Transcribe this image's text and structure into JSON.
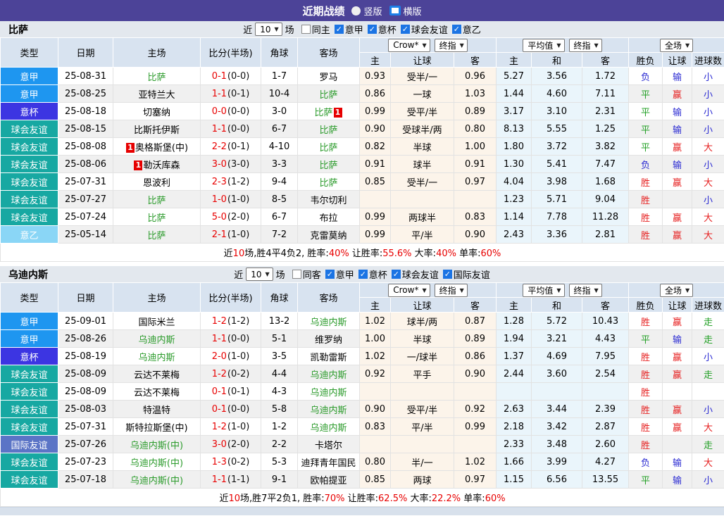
{
  "topbar": {
    "title": "近期战绩",
    "radios": [
      {
        "label": "竖版",
        "selected": false
      },
      {
        "label": "横版",
        "selected": true
      }
    ]
  },
  "type_colors": {
    "意甲": "#1e96f0",
    "意杯": "#3c35e2",
    "球会友谊": "#17a8a2",
    "意乙": "#8ad6f6",
    "国际友谊": "#5b74c6"
  },
  "result_colors": {
    "胜": "#e62020",
    "赢": "#e62020",
    "大": "#e62020",
    "负": "#2a2ad2",
    "输": "#2a2ad2",
    "小": "#2a2ad2",
    "平": "#23a026",
    "走": "#23a026"
  },
  "columns": [
    "类型",
    "日期",
    "主场",
    "比分(半场)",
    "角球",
    "客场"
  ],
  "sub_columns": [
    "主",
    "让球",
    "客",
    "主",
    "和",
    "客",
    "胜负",
    "让球",
    "进球数"
  ],
  "sections": [
    {
      "team": "比萨",
      "filter": {
        "near_label": "近",
        "count": "10",
        "games_label": "场",
        "checkboxes": [
          {
            "label": "同主",
            "checked": false
          },
          {
            "label": "意甲",
            "checked": true
          },
          {
            "label": "意杯",
            "checked": true
          },
          {
            "label": "球会友谊",
            "checked": true
          },
          {
            "label": "意乙",
            "checked": true
          }
        ]
      },
      "selects": {
        "bookmaker": "Crow*",
        "odds_time1": "终指",
        "average": "平均值",
        "odds_time2": "终指",
        "scope": "全场"
      },
      "rows": [
        {
          "type": "意甲",
          "date": "25-08-31",
          "home": {
            "name": "比萨",
            "green": true
          },
          "score": "0-1",
          "half": "(0-0)",
          "corner": "1-7",
          "away": {
            "name": "罗马",
            "green": false
          },
          "crow": [
            "0.93",
            "受半/一",
            "0.96"
          ],
          "avg": [
            "5.27",
            "3.56",
            "1.72"
          ],
          "res": [
            "负",
            "输",
            "小"
          ]
        },
        {
          "type": "意甲",
          "date": "25-08-25",
          "home": {
            "name": "亚特兰大",
            "green": false
          },
          "score": "1-1",
          "half": "(0-1)",
          "corner": "10-4",
          "away": {
            "name": "比萨",
            "green": true
          },
          "crow": [
            "0.86",
            "一球",
            "1.03"
          ],
          "avg": [
            "1.44",
            "4.60",
            "7.11"
          ],
          "res": [
            "平",
            "赢",
            "小"
          ]
        },
        {
          "type": "意杯",
          "date": "25-08-18",
          "home": {
            "name": "切塞纳",
            "green": false
          },
          "score": "0-0",
          "half": "(0-0)",
          "corner": "3-0",
          "away": {
            "name": "比萨",
            "green": true,
            "badge": "1",
            "badge_pos": "after"
          },
          "crow": [
            "0.99",
            "受平/半",
            "0.89"
          ],
          "avg": [
            "3.17",
            "3.10",
            "2.31"
          ],
          "res": [
            "平",
            "输",
            "小"
          ]
        },
        {
          "type": "球会友谊",
          "date": "25-08-15",
          "home": {
            "name": "比斯托伊斯",
            "green": false
          },
          "score": "1-1",
          "half": "(0-0)",
          "corner": "6-7",
          "away": {
            "name": "比萨",
            "green": true
          },
          "crow": [
            "0.90",
            "受球半/两",
            "0.80"
          ],
          "avg": [
            "8.13",
            "5.55",
            "1.25"
          ],
          "res": [
            "平",
            "输",
            "小"
          ]
        },
        {
          "type": "球会友谊",
          "date": "25-08-08",
          "home": {
            "name": "奥格斯堡(中)",
            "green": false,
            "badge": "1",
            "badge_pos": "before"
          },
          "score": "2-2",
          "half": "(0-1)",
          "corner": "4-10",
          "away": {
            "name": "比萨",
            "green": true
          },
          "crow": [
            "0.82",
            "半球",
            "1.00"
          ],
          "avg": [
            "1.80",
            "3.72",
            "3.82"
          ],
          "res": [
            "平",
            "赢",
            "大"
          ]
        },
        {
          "type": "球会友谊",
          "date": "25-08-06",
          "home": {
            "name": "勒沃库森",
            "green": false,
            "badge": "1",
            "badge_pos": "before"
          },
          "score": "3-0",
          "half": "(3-0)",
          "corner": "3-3",
          "away": {
            "name": "比萨",
            "green": true
          },
          "crow": [
            "0.91",
            "球半",
            "0.91"
          ],
          "avg": [
            "1.30",
            "5.41",
            "7.47"
          ],
          "res": [
            "负",
            "输",
            "小"
          ]
        },
        {
          "type": "球会友谊",
          "date": "25-07-31",
          "home": {
            "name": "恩波利",
            "green": false
          },
          "score": "2-3",
          "half": "(1-2)",
          "corner": "9-4",
          "away": {
            "name": "比萨",
            "green": true
          },
          "crow": [
            "0.85",
            "受半/一",
            "0.97"
          ],
          "avg": [
            "4.04",
            "3.98",
            "1.68"
          ],
          "res": [
            "胜",
            "赢",
            "大"
          ]
        },
        {
          "type": "球会友谊",
          "date": "25-07-27",
          "home": {
            "name": "比萨",
            "green": true
          },
          "score": "1-0",
          "half": "(1-0)",
          "corner": "8-5",
          "away": {
            "name": "韦尔切利",
            "green": false
          },
          "crow": [
            "",
            "",
            ""
          ],
          "avg": [
            "1.23",
            "5.71",
            "9.04"
          ],
          "res": [
            "胜",
            "",
            "小"
          ]
        },
        {
          "type": "球会友谊",
          "date": "25-07-24",
          "home": {
            "name": "比萨",
            "green": true
          },
          "score": "5-0",
          "half": "(2-0)",
          "corner": "6-7",
          "away": {
            "name": "布拉",
            "green": false
          },
          "crow": [
            "0.99",
            "两球半",
            "0.83"
          ],
          "avg": [
            "1.14",
            "7.78",
            "11.28"
          ],
          "res": [
            "胜",
            "赢",
            "大"
          ]
        },
        {
          "type": "意乙",
          "date": "25-05-14",
          "home": {
            "name": "比萨",
            "green": true
          },
          "score": "2-1",
          "half": "(1-0)",
          "corner": "7-2",
          "away": {
            "name": "克雷莫纳",
            "green": false
          },
          "crow": [
            "0.99",
            "平/半",
            "0.90"
          ],
          "avg": [
            "2.43",
            "3.36",
            "2.81"
          ],
          "res": [
            "胜",
            "赢",
            "大"
          ]
        }
      ],
      "summary": [
        {
          "t": "近",
          "r": 0
        },
        {
          "t": "10",
          "r": 1
        },
        {
          "t": "场,胜4平4负2, 胜率:",
          "r": 0
        },
        {
          "t": "40%",
          "r": 1
        },
        {
          "t": " 让胜率:",
          "r": 0
        },
        {
          "t": "55.6%",
          "r": 1
        },
        {
          "t": " 大率:",
          "r": 0
        },
        {
          "t": "40%",
          "r": 1
        },
        {
          "t": " 单率:",
          "r": 0
        },
        {
          "t": "60%",
          "r": 1
        }
      ]
    },
    {
      "team": "乌迪内斯",
      "filter": {
        "near_label": "近",
        "count": "10",
        "games_label": "场",
        "checkboxes": [
          {
            "label": "同客",
            "checked": false
          },
          {
            "label": "意甲",
            "checked": true
          },
          {
            "label": "意杯",
            "checked": true
          },
          {
            "label": "球会友谊",
            "checked": true
          },
          {
            "label": "国际友谊",
            "checked": true
          }
        ]
      },
      "selects": {
        "bookmaker": "Crow*",
        "odds_time1": "终指",
        "average": "平均值",
        "odds_time2": "终指",
        "scope": "全场"
      },
      "rows": [
        {
          "type": "意甲",
          "date": "25-09-01",
          "home": {
            "name": "国际米兰",
            "green": false
          },
          "score": "1-2",
          "half": "(1-2)",
          "corner": "13-2",
          "away": {
            "name": "乌迪内斯",
            "green": true
          },
          "crow": [
            "1.02",
            "球半/两",
            "0.87"
          ],
          "avg": [
            "1.28",
            "5.72",
            "10.43"
          ],
          "res": [
            "胜",
            "赢",
            "走"
          ]
        },
        {
          "type": "意甲",
          "date": "25-08-26",
          "home": {
            "name": "乌迪内斯",
            "green": true
          },
          "score": "1-1",
          "half": "(0-0)",
          "corner": "5-1",
          "away": {
            "name": "维罗纳",
            "green": false
          },
          "crow": [
            "1.00",
            "半球",
            "0.89"
          ],
          "avg": [
            "1.94",
            "3.21",
            "4.43"
          ],
          "res": [
            "平",
            "输",
            "走"
          ]
        },
        {
          "type": "意杯",
          "date": "25-08-19",
          "home": {
            "name": "乌迪内斯",
            "green": true
          },
          "score": "2-0",
          "half": "(1-0)",
          "corner": "3-5",
          "away": {
            "name": "凯勒雷斯",
            "green": false
          },
          "crow": [
            "1.02",
            "一/球半",
            "0.86"
          ],
          "avg": [
            "1.37",
            "4.69",
            "7.95"
          ],
          "res": [
            "胜",
            "赢",
            "小"
          ]
        },
        {
          "type": "球会友谊",
          "date": "25-08-09",
          "home": {
            "name": "云达不莱梅",
            "green": false
          },
          "score": "1-2",
          "half": "(0-2)",
          "corner": "4-4",
          "away": {
            "name": "乌迪内斯",
            "green": true
          },
          "crow": [
            "0.92",
            "平手",
            "0.90"
          ],
          "avg": [
            "2.44",
            "3.60",
            "2.54"
          ],
          "res": [
            "胜",
            "赢",
            "走"
          ]
        },
        {
          "type": "球会友谊",
          "date": "25-08-09",
          "home": {
            "name": "云达不莱梅",
            "green": false
          },
          "score": "0-1",
          "half": "(0-1)",
          "corner": "4-3",
          "away": {
            "name": "乌迪内斯",
            "green": true
          },
          "crow": [
            "",
            "",
            ""
          ],
          "avg": [
            "",
            "",
            ""
          ],
          "res": [
            "胜",
            "",
            ""
          ]
        },
        {
          "type": "球会友谊",
          "date": "25-08-03",
          "home": {
            "name": "特温特",
            "green": false
          },
          "score": "0-1",
          "half": "(0-0)",
          "corner": "5-8",
          "away": {
            "name": "乌迪内斯",
            "green": true
          },
          "crow": [
            "0.90",
            "受平/半",
            "0.92"
          ],
          "avg": [
            "2.63",
            "3.44",
            "2.39"
          ],
          "res": [
            "胜",
            "赢",
            "小"
          ]
        },
        {
          "type": "球会友谊",
          "date": "25-07-31",
          "home": {
            "name": "斯特拉斯堡(中)",
            "green": false
          },
          "score": "1-2",
          "half": "(1-0)",
          "corner": "1-2",
          "away": {
            "name": "乌迪内斯",
            "green": true
          },
          "crow": [
            "0.83",
            "平/半",
            "0.99"
          ],
          "avg": [
            "2.18",
            "3.42",
            "2.87"
          ],
          "res": [
            "胜",
            "赢",
            "大"
          ]
        },
        {
          "type": "国际友谊",
          "date": "25-07-26",
          "home": {
            "name": "乌迪内斯(中)",
            "green": true
          },
          "score": "3-0",
          "half": "(2-0)",
          "corner": "2-2",
          "away": {
            "name": "卡塔尔",
            "green": false
          },
          "crow": [
            "",
            "",
            ""
          ],
          "avg": [
            "2.33",
            "3.48",
            "2.60"
          ],
          "res": [
            "胜",
            "",
            "走"
          ]
        },
        {
          "type": "球会友谊",
          "date": "25-07-23",
          "home": {
            "name": "乌迪内斯(中)",
            "green": true
          },
          "score": "1-3",
          "half": "(0-2)",
          "corner": "5-3",
          "away": {
            "name": "迪拜青年国民",
            "green": false
          },
          "crow": [
            "0.80",
            "半/一",
            "1.02"
          ],
          "avg": [
            "1.66",
            "3.99",
            "4.27"
          ],
          "res": [
            "负",
            "输",
            "大"
          ]
        },
        {
          "type": "球会友谊",
          "date": "25-07-18",
          "home": {
            "name": "乌迪内斯(中)",
            "green": true
          },
          "score": "1-1",
          "half": "(1-1)",
          "corner": "9-1",
          "away": {
            "name": "欧帕提亚",
            "green": false
          },
          "crow": [
            "0.85",
            "两球",
            "0.97"
          ],
          "avg": [
            "1.15",
            "6.56",
            "13.55"
          ],
          "res": [
            "平",
            "输",
            "小"
          ]
        }
      ],
      "summary": [
        {
          "t": "近",
          "r": 0
        },
        {
          "t": "10",
          "r": 1
        },
        {
          "t": "场,胜7平2负1, 胜率:",
          "r": 0
        },
        {
          "t": "70%",
          "r": 1
        },
        {
          "t": " 让胜率:",
          "r": 0
        },
        {
          "t": "62.5%",
          "r": 1
        },
        {
          "t": " 大率:",
          "r": 0
        },
        {
          "t": "22.2%",
          "r": 1
        },
        {
          "t": " 单率:",
          "r": 0
        },
        {
          "t": "60%",
          "r": 1
        }
      ]
    }
  ]
}
